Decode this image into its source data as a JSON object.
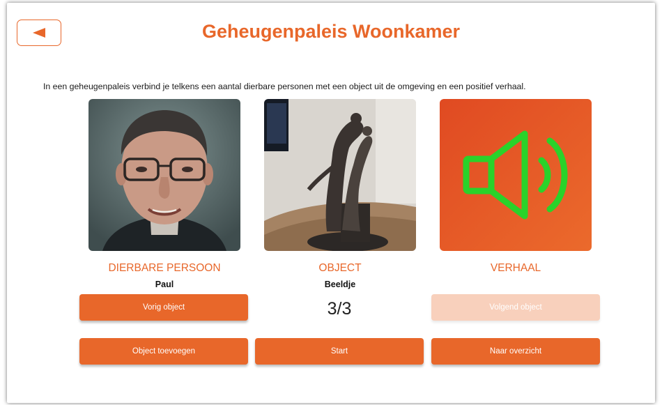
{
  "header": {
    "title": "Geheugenpaleis Woonkamer",
    "back_icon": "arrow-left-icon"
  },
  "intro_text": "In een geheugenpaleis verbind je telkens een aantal dierbare personen met een object uit de omgeving en een positief verhaal.",
  "columns": [
    {
      "label": "DIERBARE PERSOON",
      "value": "Paul",
      "image": "portrait-photo"
    },
    {
      "label": "OBJECT",
      "value": "Beeldje",
      "image": "statue-photo"
    },
    {
      "label": "VERHAAL",
      "value": "",
      "image": "speaker-icon"
    }
  ],
  "counter": "3/3",
  "buttons": {
    "prev": "Vorig object",
    "next": "Volgend object",
    "add": "Object toevoegen",
    "start": "Start",
    "overview": "Naar overzicht"
  },
  "colors": {
    "accent": "#e8672a",
    "accent_disabled": "#f8d0bc",
    "speaker_green": "#2ad22a"
  }
}
